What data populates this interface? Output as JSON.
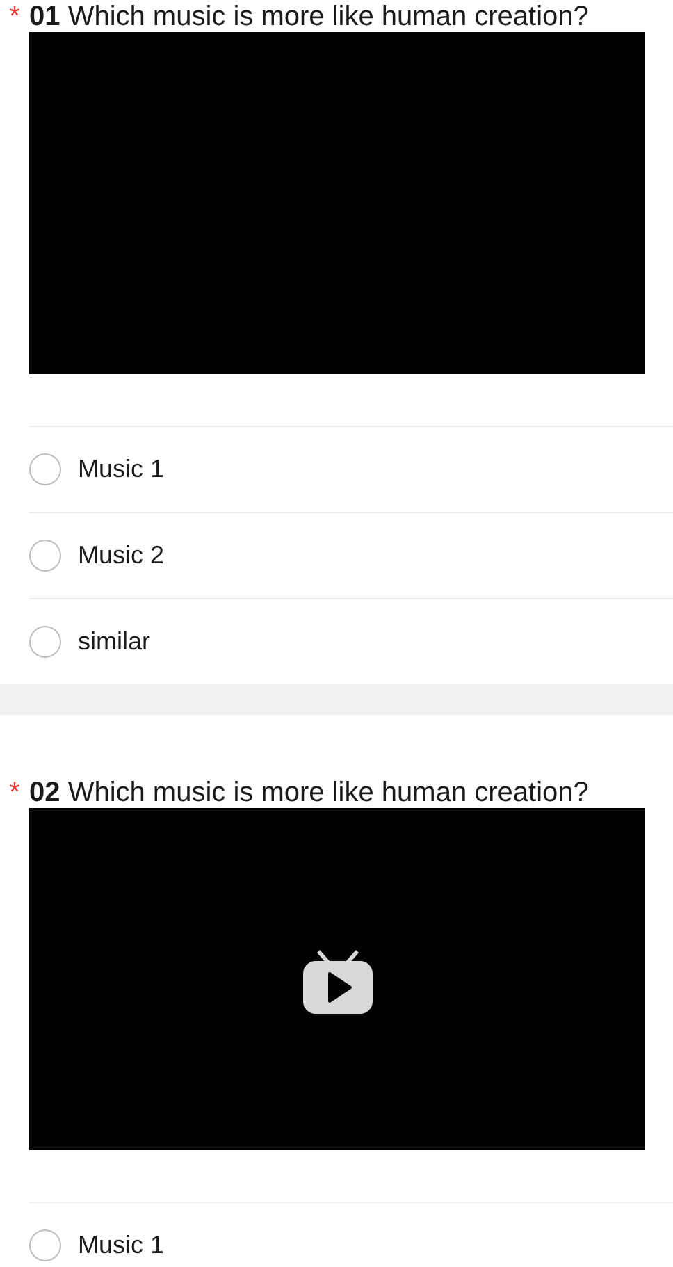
{
  "questions": [
    {
      "required_mark": "*",
      "number": "01",
      "title": "Which music is more like human creation?",
      "video": {
        "play_icon": false
      },
      "options": [
        {
          "label": "Music 1",
          "selected": false
        },
        {
          "label": "Music 2",
          "selected": false
        },
        {
          "label": "similar",
          "selected": false
        }
      ]
    },
    {
      "required_mark": "*",
      "number": "02",
      "title": "Which music is more like human creation?",
      "video": {
        "play_icon": true
      },
      "options": [
        {
          "label": "Music 1",
          "selected": false
        }
      ]
    }
  ]
}
